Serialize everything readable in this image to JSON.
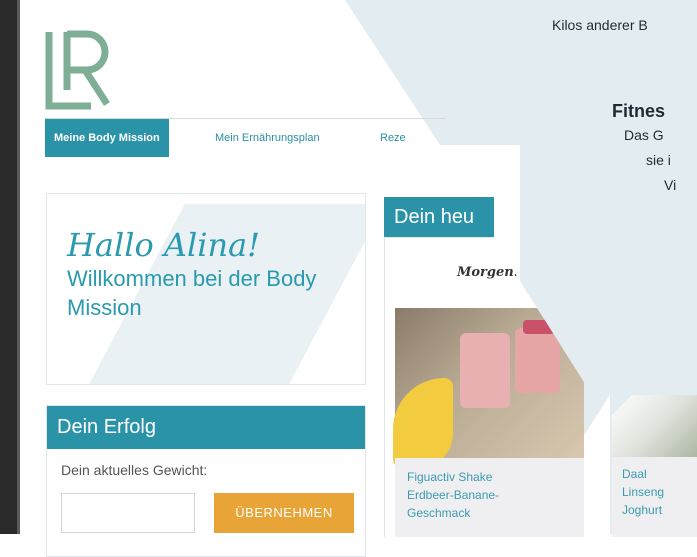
{
  "right_panel": {
    "line1": "Kilos anderer B",
    "heading": "Fitnes",
    "line2": "Das G",
    "line3": "sie i",
    "line4": "Vi"
  },
  "nav": {
    "tabs": [
      {
        "label": "Meine Body Mission"
      },
      {
        "label": "Mein Ernährungsplan"
      },
      {
        "label": "Reze"
      }
    ]
  },
  "welcome": {
    "greeting": "Hallo Alina!",
    "subtitle": "Willkommen bei der Body Mission"
  },
  "success": {
    "title": "Dein Erfolg",
    "weight_label": "Dein aktuelles Gewicht:",
    "weight_value": "",
    "apply_label": "ÜBERNEHMEN"
  },
  "today": {
    "title": "Dein heu",
    "meal_time": "Morgen.",
    "recipes": [
      {
        "lines": [
          "Figuactiv Shake",
          "Erdbeer-Banane-",
          "Geschmack"
        ]
      },
      {
        "lines": [
          "Daal",
          "Linseng",
          "Joghurt"
        ]
      }
    ]
  },
  "colors": {
    "brand_teal": "#2a93a8",
    "button_orange": "#e8a437",
    "logo_green": "#7fae96"
  }
}
